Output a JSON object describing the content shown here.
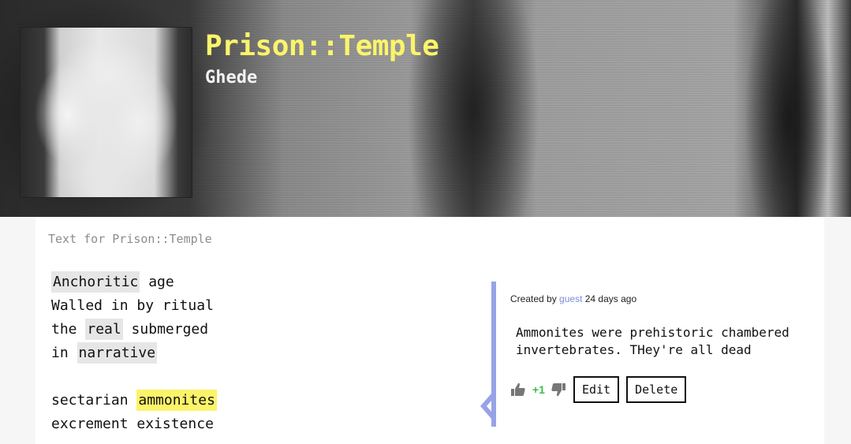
{
  "header": {
    "title": "Prison::Temple",
    "artist": "Ghede"
  },
  "panel": {
    "heading": "Text for Prison::Temple"
  },
  "lyrics": {
    "line1": {
      "a": "Anchoritic",
      "b": " age"
    },
    "line2": "Walled in by ritual",
    "line3": {
      "a": "the ",
      "b": "real",
      "c": " submerged"
    },
    "line4": {
      "a": "in ",
      "b": "narrative"
    },
    "line5": {
      "a": "sectarian ",
      "b": "ammonites"
    },
    "line6": "excrement existence"
  },
  "annotation": {
    "created_prefix": "Created by ",
    "author": "guest",
    "created_suffix": " 24 days ago",
    "body": "Ammonites were prehistoric chambered invertebrates. THey're all dead",
    "score": "+1",
    "edit_label": "Edit",
    "delete_label": "Delete",
    "upvote_icon": "thumbs-up-icon",
    "downvote_icon": "thumbs-down-icon"
  },
  "colors": {
    "title_yellow": "#fbf46a",
    "annotation_border": "#98a3e6",
    "link": "#7f8bd9",
    "score_green": "#3cbf4a",
    "highlight_active": "#fbf46a",
    "highlight_inactive": "#e6e6e6"
  }
}
